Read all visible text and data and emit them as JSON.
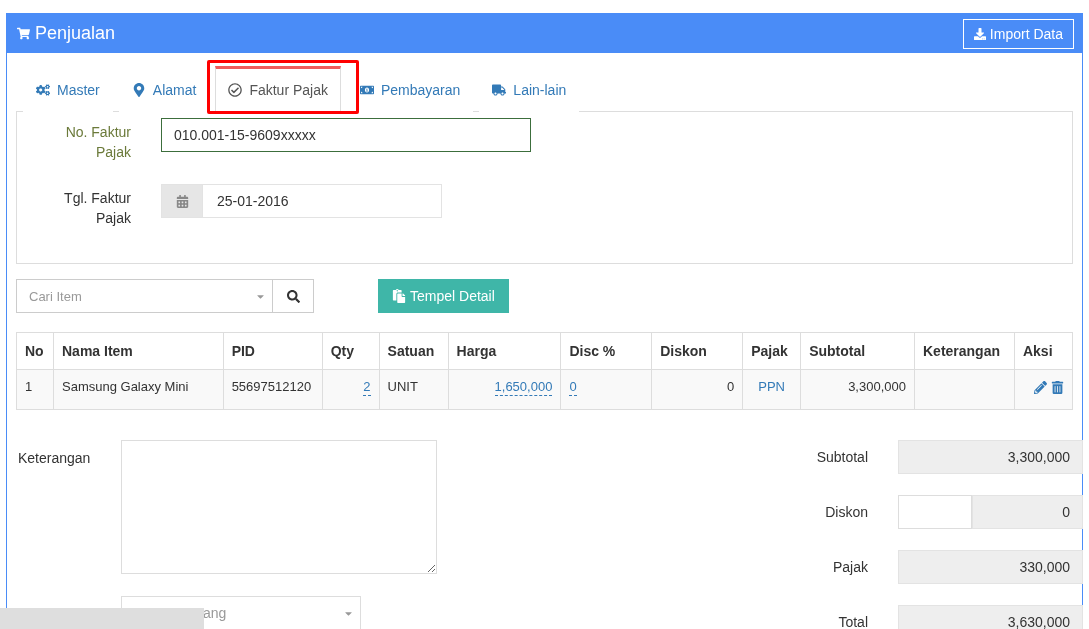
{
  "header": {
    "title": "Penjualan",
    "import_button": "Import Data"
  },
  "tabs": [
    {
      "label": "Master",
      "selected": false
    },
    {
      "label": "Alamat",
      "selected": false
    },
    {
      "label": "Faktur Pajak",
      "selected": true
    },
    {
      "label": "Pembayaran",
      "selected": false
    },
    {
      "label": "Lain-lain",
      "selected": false
    }
  ],
  "faktur_form": {
    "no_label": "No. Faktur Pajak",
    "no_value": "010.001-15-9609xxxxx",
    "tgl_label": "Tgl. Faktur Pajak",
    "tgl_value": "25-01-2016"
  },
  "item_search": {
    "placeholder": "Cari Item"
  },
  "paste_button": "Tempel Detail",
  "table": {
    "columns": [
      "No",
      "Nama Item",
      "PID",
      "Qty",
      "Satuan",
      "Harga",
      "Disc %",
      "Diskon",
      "Pajak",
      "Subtotal",
      "Keterangan",
      "Aksi"
    ],
    "rows": [
      {
        "cells": [
          {
            "text": "1",
            "kind": "plain"
          },
          {
            "text": "Samsung Galaxy Mini",
            "kind": "plain"
          },
          {
            "text": "55697512120",
            "kind": "plain"
          },
          {
            "text": "2",
            "kind": "editable"
          },
          {
            "text": "UNIT",
            "kind": "plain"
          },
          {
            "text": "1,650,000",
            "kind": "editable"
          },
          {
            "text": "0",
            "kind": "editable"
          },
          {
            "text": "0",
            "kind": "number"
          },
          {
            "text": "PPN",
            "kind": "link"
          },
          {
            "text": "3,300,000",
            "kind": "number"
          },
          {
            "text": "",
            "kind": "plain"
          },
          {
            "text": "",
            "kind": "actions"
          }
        ]
      }
    ]
  },
  "keterangan": {
    "label": "Keterangan"
  },
  "partial_select": {
    "placeholder": "ang"
  },
  "totals": [
    {
      "label": "Subtotal",
      "value": "3,300,000",
      "kind": "plain"
    },
    {
      "label": "Diskon",
      "value": "0",
      "kind": "split"
    },
    {
      "label": "Pajak",
      "value": "330,000",
      "kind": "plain"
    },
    {
      "label": "Total",
      "value": "3,630,000",
      "kind": "plain"
    }
  ]
}
